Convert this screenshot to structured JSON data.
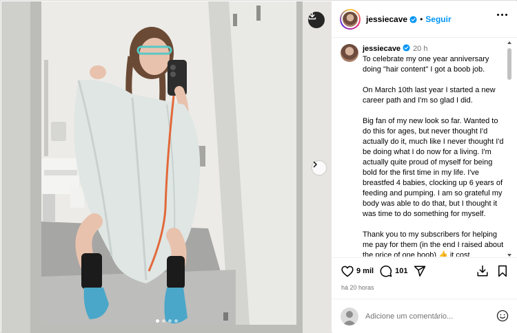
{
  "post": {
    "username": "jessiecave",
    "follow_label": "Seguir",
    "separator": "•",
    "caption_time": "20 h",
    "caption_paragraphs": [
      "To celebrate my one year anniversary doing \"hair content\" I got a boob job.",
      "On March 10th last year I started a new career path and I'm so glad I did.",
      "Big fan of my new look so far. Wanted to do this for ages, but never thought I'd actually do it, much like I never thought I'd be doing what I do now for a living. I'm actually quite proud of myself for being bold for the first time in my life. I've breastfed 4 babies, clocking up 6 years of feeding and pumping. I am so grateful my body was able to do that, but I thought it was time to do something for myself.",
      "Thank you to my subscribers for helping me pay for them (in the end I raised about the price of one boob) 👍 it cost"
    ],
    "likes": "9 mil",
    "comments_count": "101",
    "time_ago": "há 20 horas",
    "comment_placeholder": "Adicione um comentário...",
    "carousel": {
      "count": 4,
      "active_index": 0
    }
  },
  "icons": {
    "download": "download-icon",
    "next": "chevron-right-icon",
    "verified": "verified-badge-icon",
    "more": "more-options-icon",
    "like": "heart-icon",
    "comment": "comment-icon",
    "share": "send-icon",
    "save": "bookmark-icon",
    "emoji": "emoji-icon"
  },
  "colors": {
    "accent": "#0095f6",
    "muted_text": "#737373",
    "divider": "#efefef"
  }
}
